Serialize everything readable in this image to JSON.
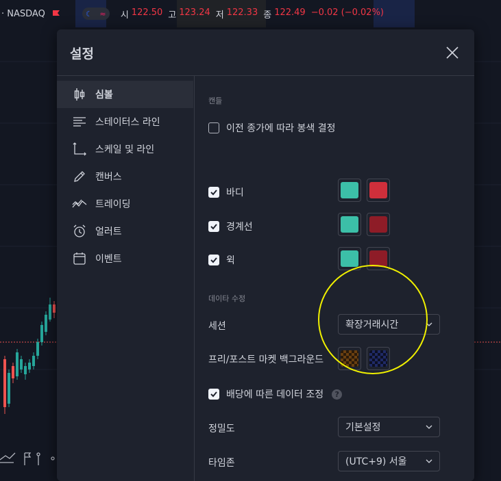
{
  "topbar": {
    "symbol": "· NASDAQ",
    "ohlc": [
      {
        "k": "시",
        "v": "122.50"
      },
      {
        "k": "고",
        "v": "123.24"
      },
      {
        "k": "저",
        "v": "122.33"
      },
      {
        "k": "종",
        "v": "122.49"
      }
    ],
    "change": "−0.02 (−0.02%)"
  },
  "dialog": {
    "title": "설정",
    "sidebar": [
      {
        "label": "심볼",
        "icon": "candles-icon",
        "active": true
      },
      {
        "label": "스테이터스 라인",
        "icon": "status-line-icon"
      },
      {
        "label": "스케일 및 라인",
        "icon": "scales-icon"
      },
      {
        "label": "캔버스",
        "icon": "pencil-icon"
      },
      {
        "label": "트레이딩",
        "icon": "trading-icon"
      },
      {
        "label": "얼러트",
        "icon": "alarm-clock-icon"
      },
      {
        "label": "이벤트",
        "icon": "calendar-icon"
      }
    ],
    "candles": {
      "section": "캔들",
      "prev_close_color": {
        "label": "이전 종가에 따라 봉색 결정",
        "checked": false
      },
      "body": {
        "label": "바디",
        "checked": true,
        "up": "#3cbfa8",
        "down": "#cf2f3b"
      },
      "border": {
        "label": "경계선",
        "checked": true,
        "up": "#3cbfa8",
        "down": "#8e1c27"
      },
      "wick": {
        "label": "윅",
        "checked": true,
        "up": "#3cbfa8",
        "down": "#8e1c27"
      }
    },
    "data": {
      "section": "데이타 수정",
      "session": {
        "label": "세션",
        "value": "확장거래시간"
      },
      "prepost": {
        "label": "프리/포스트 마켓 백그라운드"
      },
      "dividend": {
        "label": "배당에 따른 데이터 조정",
        "checked": true
      },
      "precision": {
        "label": "정밀도",
        "value": "기본설정"
      },
      "timezone": {
        "label": "타임존",
        "value": "(UTC+9) 서울"
      }
    }
  },
  "colors": {
    "accent": "#2962ff",
    "up": "#26a69a",
    "down": "#ef5350",
    "highlight": "#f0f000"
  }
}
